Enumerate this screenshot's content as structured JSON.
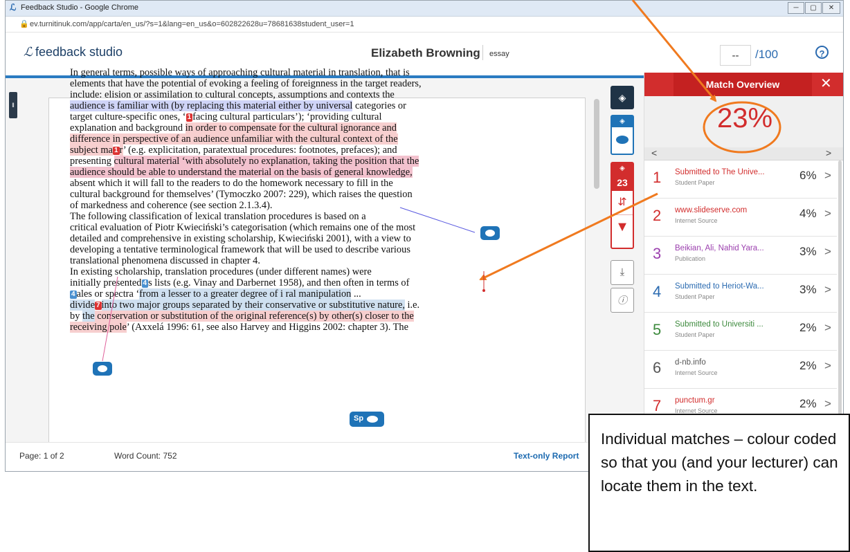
{
  "browser": {
    "window_title": "Feedback Studio - Google Chrome",
    "url": "ev.turnitinuk.com/app/carta/en_us/?s=1&lang=en_us&o=602822628u=78681638student_user=1",
    "controls": [
      "─",
      "▢",
      "✕"
    ]
  },
  "header": {
    "brand": "feedback studio",
    "student_name": "Elizabeth Browning",
    "paper_type": "essay",
    "grade_value": "--",
    "grade_out_of": "/100",
    "help_icon": "?"
  },
  "document": {
    "lines": [
      [
        {
          "t": "In general terms, possible ways of approaching cultural material in translation, that is"
        }
      ],
      [
        {
          "t": "elements that have the potential of evoking a feeling of foreignness in the target readers,"
        }
      ],
      [
        {
          "t": "include: elision or assimilation to cultural concepts, assumptions and contexts the"
        }
      ],
      [
        {
          "t": "audience is familiar with (by replacing this material either by universal",
          "h": "blue"
        },
        {
          "t": " categories or"
        }
      ],
      [
        {
          "t": "target culture-specific ones, ‘"
        },
        {
          "m": "1",
          "c": "red"
        },
        {
          "t": "facing cultural particulars’); ‘providing cultural"
        }
      ],
      [
        {
          "t": "explanation and background "
        },
        {
          "t": "in order to compensate for the cultural ignorance and",
          "h": "red"
        }
      ],
      [
        {
          "t": "difference in perspective of an audience unfamiliar with the cultural context of the",
          "h": "red"
        }
      ],
      [
        {
          "t": "subject ma",
          "h": "red"
        },
        {
          "m": "1",
          "c": "red"
        },
        {
          "t": "r",
          "h": "red"
        },
        {
          "t": "’ (e.g. explicitation, paratextual procedures: footnotes, prefaces); and"
        }
      ],
      [
        {
          "t": "presenting "
        },
        {
          "t": "cultural material ‘with absolutely no explanation, taking the position that the",
          "h": "pink"
        }
      ],
      [
        {
          "t": "audience should be able to understand the material on the basis of general knowledge,",
          "h": "pink"
        }
      ],
      [
        {
          "t": "absent which it will fall to the readers to do the homework necessary to fill in the"
        }
      ],
      [
        {
          "t": "cultural background for themselves’ (Tymoczko 2007: 229), which raises the question"
        }
      ],
      [
        {
          "t": "of markedness and coherence (see section 2.1.3.4)."
        }
      ],
      [
        {
          "t": "The following classification of lexical translation procedures is based on a"
        }
      ],
      [
        {
          "t": "critical evaluation of Piotr Kwieciński’s categorisation (which remains one of the most"
        }
      ],
      [
        {
          "t": "detailed and comprehensive in existing scholarship, Kwieciński 2001), with a view to"
        }
      ],
      [
        {
          "t": "developing a tentative terminological framework that will be used to describe various"
        }
      ],
      [
        {
          "t": "translational phenomena discussed in chapter 4."
        }
      ],
      [
        {
          "t": "In existing scholarship, translation procedures (under different names) were"
        }
      ],
      [
        {
          "t": "initially presented"
        },
        {
          "m": "4",
          "c": "blue"
        },
        {
          "t": "s lists (e.g. Vinay and Darbernet 1958), and then often in terms of"
        }
      ],
      [
        {
          "m": "4",
          "c": "blue"
        },
        {
          "t": "ales or spectra ‘"
        },
        {
          "t": "from a lesser to a greater degree of i          ral manipulation",
          "h": "lblue"
        },
        {
          "t": " ..."
        }
      ],
      [
        {
          "t": "divide",
          "h": "lblue"
        },
        {
          "m": "7",
          "c": "red"
        },
        {
          "t": "into two major groups separated by their conservative or substitutive nature,",
          "h": "lblue"
        },
        {
          "t": " i.e."
        }
      ],
      [
        {
          "t": "by "
        },
        {
          "t": "the",
          "h": "lblue"
        },
        {
          "t": " conservation or substitution of the original reference(s) by other(s) closer to the",
          "h": "red"
        }
      ],
      [
        {
          "t": "receiving pole",
          "h": "red"
        },
        {
          "t": "’ (Axxelá 1996: 61, see also Harvey and Higgins 2002: chapter 3). The"
        }
      ]
    ],
    "sp_label": "Sp"
  },
  "footer": {
    "page": "Page: 1 of 2",
    "word_count": "Word Count: 752",
    "text_only": "Text-only Report"
  },
  "toolbar": {
    "match_count": "23"
  },
  "panel": {
    "title": "Match Overview",
    "overall": "23%",
    "prev": "<",
    "next": ">",
    "matches": [
      {
        "num": "1",
        "source": "Submitted to The Unive...",
        "type": "Student Paper",
        "pct": "6%",
        "color": "#d22d2d"
      },
      {
        "num": "2",
        "source": "www.slideserve.com",
        "type": "Internet Source",
        "pct": "4%",
        "color": "#d22d2d"
      },
      {
        "num": "3",
        "source": "Beikian, Ali, Nahid Yara...",
        "type": "Publication",
        "pct": "3%",
        "color": "#9b3fae"
      },
      {
        "num": "4",
        "source": "Submitted to Heriot-Wa...",
        "type": "Student Paper",
        "pct": "3%",
        "color": "#2a6ab0"
      },
      {
        "num": "5",
        "source": "Submitted to Universiti ...",
        "type": "Student Paper",
        "pct": "2%",
        "color": "#3d8a3d"
      },
      {
        "num": "6",
        "source": "d-nb.info",
        "type": "Internet Source",
        "pct": "2%",
        "color": "#555555"
      },
      {
        "num": "7",
        "source": "punctum.gr",
        "type": "Internet Source",
        "pct": "2%",
        "color": "#d22d2d"
      }
    ]
  },
  "annotation": {
    "callout_text": "Individual matches – colour coded so that you (and your lecturer) can locate them in the text.",
    "arrow_color": "#f07a1f"
  }
}
